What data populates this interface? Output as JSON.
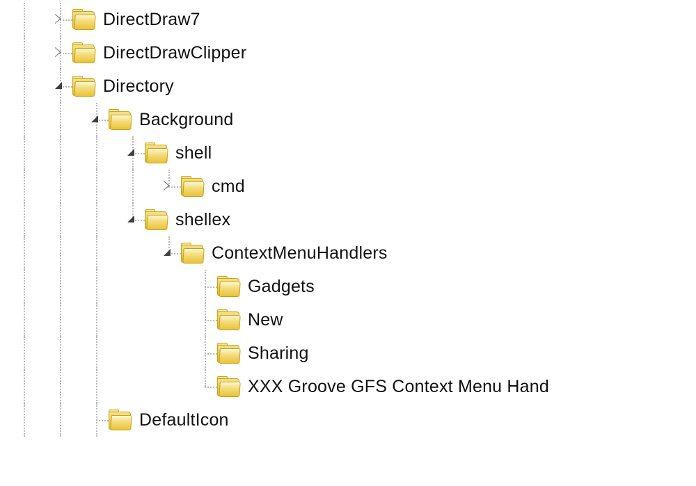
{
  "tree": {
    "directdraw7": "DirectDraw7",
    "directdrawclipper": "DirectDrawClipper",
    "directory": "Directory",
    "background": "Background",
    "shell": "shell",
    "cmd": "cmd",
    "shellex": "shellex",
    "contextmenuhandlers": "ContextMenuHandlers",
    "gadgets": "Gadgets",
    "new": "New",
    "sharing": "Sharing",
    "xxx_groove": "XXX Groove GFS Context Menu Hand",
    "defaulticon": "DefaultIcon"
  }
}
